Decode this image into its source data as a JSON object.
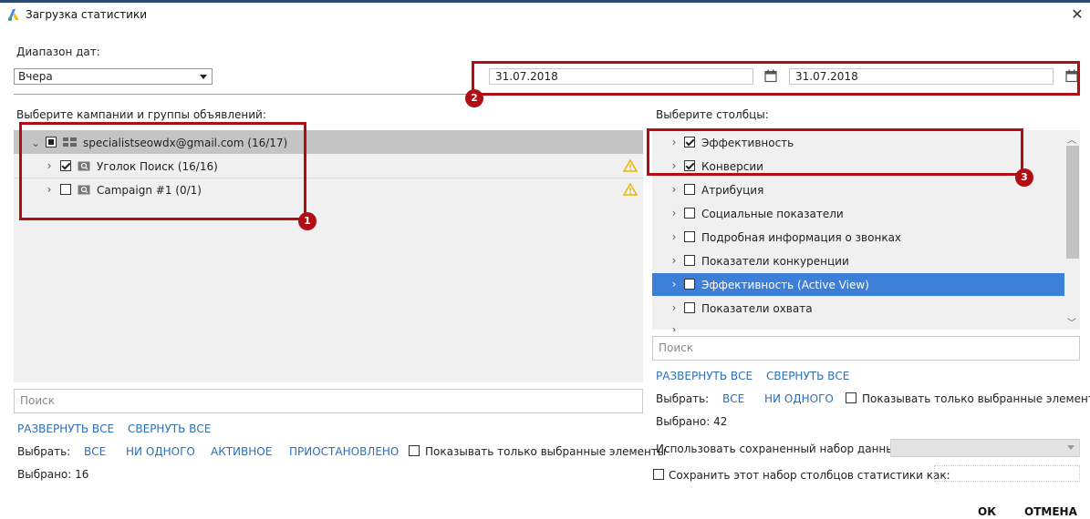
{
  "window": {
    "title": "Загрузка статистики"
  },
  "date_range": {
    "label": "Диапазон дат:",
    "preset": "Вчера",
    "start": "31.07.2018",
    "end": "31.07.2018"
  },
  "campaigns": {
    "heading": "Выберите кампании и группы объявлений:",
    "account": {
      "label": "specialistseowdx@gmail.com (16/17)"
    },
    "items": [
      {
        "label": "Уголок Поиск (16/16)",
        "checked": true
      },
      {
        "label": "Campaign #1 (0/1)",
        "checked": false
      }
    ],
    "search_placeholder": "Поиск",
    "expand_all": "РАЗВЕРНУТЬ ВСЕ",
    "collapse_all": "СВЕРНУТЬ ВСЕ",
    "select_label": "Выбрать:",
    "select_all": "ВСЕ",
    "select_none": "НИ ОДНОГО",
    "select_active": "АКТИВНОЕ",
    "select_paused": "ПРИОСТАНОВЛЕНО",
    "show_selected_only": "Показывать только выбранные элементы",
    "selected_count": "Выбрано: 16"
  },
  "columns": {
    "heading": "Выберите столбцы:",
    "items": [
      {
        "label": "Эффективность",
        "checked": true
      },
      {
        "label": "Конверсии",
        "checked": true
      },
      {
        "label": "Атрибуция",
        "checked": false
      },
      {
        "label": "Социальные показатели",
        "checked": false
      },
      {
        "label": "Подробная информация о звонках",
        "checked": false
      },
      {
        "label": "Показатели конкуренции",
        "checked": false
      },
      {
        "label": "Эффективность (Active View)",
        "checked": false,
        "highlighted": true
      },
      {
        "label": "Показатели охвата",
        "checked": false
      }
    ],
    "search_placeholder": "Поиск",
    "expand_all": "РАЗВЕРНУТЬ ВСЕ",
    "collapse_all": "СВЕРНУТЬ ВСЕ",
    "select_label": "Выбрать:",
    "select_all": "ВСЕ",
    "select_none": "НИ ОДНОГО",
    "show_selected_only": "Показывать только выбранные элементы",
    "selected_count": "Выбрано: 42",
    "saved_set_label": "Использовать сохраненный набор данных:",
    "save_set_label": "Сохранить этот набор столбцов статистики как:"
  },
  "annotations": [
    "1",
    "2",
    "3"
  ],
  "buttons": {
    "ok": "ОК",
    "cancel": "ОТМЕНА"
  },
  "colors": {
    "annotation": "#b00d14",
    "link": "#2c6fb7",
    "selection": "#3c7fd9",
    "account_row": "#c4c4c4",
    "warning": "#e8b400"
  }
}
